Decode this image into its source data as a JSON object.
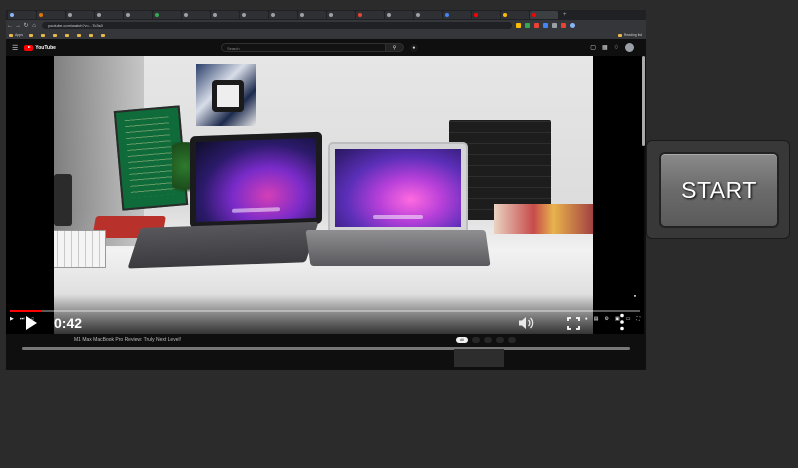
{
  "browser": {
    "tabs": [
      {
        "label": "",
        "color": "#8ab4f8"
      },
      {
        "label": "",
        "color": "#e37400"
      },
      {
        "label": "",
        "color": "#9aa0a6"
      },
      {
        "label": "",
        "color": "#9aa0a6"
      },
      {
        "label": "",
        "color": "#9aa0a6"
      },
      {
        "label": "",
        "color": "#34a853"
      },
      {
        "label": "",
        "color": "#9aa0a6"
      },
      {
        "label": "",
        "color": "#9aa0a6"
      },
      {
        "label": "",
        "color": "#9aa0a6"
      },
      {
        "label": "",
        "color": "#9aa0a6"
      },
      {
        "label": "",
        "color": "#9aa0a6"
      },
      {
        "label": "",
        "color": "#9aa0a6"
      },
      {
        "label": "",
        "color": "#ea4335"
      },
      {
        "label": "",
        "color": "#9aa0a6"
      },
      {
        "label": "",
        "color": "#9aa0a6"
      },
      {
        "label": "",
        "color": "#4285f4"
      },
      {
        "label": "",
        "color": "#ff0000"
      },
      {
        "label": "",
        "color": "#fbbc04"
      },
      {
        "label": "",
        "color": "#ff0000"
      }
    ],
    "url": "youtube.com/watch?v=...Tc3s0",
    "bookmarks": [
      "Apps",
      "",
      "",
      "",
      "",
      "",
      "",
      ""
    ],
    "bookmarks_right": "Reading list"
  },
  "youtube": {
    "logo_text": "YouTube",
    "search_placeholder": "Search",
    "player": {
      "current_time": "0:42",
      "progress_fraction": 0.05
    },
    "video_title": "M1 Max MacBook Pro Review: Truly Next Level!",
    "chips": [
      "All",
      "",
      "",
      "",
      ""
    ]
  },
  "overlay": {
    "start_label": "START"
  },
  "colors": {
    "accent_red": "#ff0000",
    "start_button_bg": "#6b6b6b"
  },
  "icons": {
    "menu": "hamburger-menu-icon",
    "search": "search-icon",
    "mic": "microphone-icon",
    "play": "play-icon",
    "volume": "volume-icon",
    "fullscreen": "fullscreen-icon",
    "more": "more-vertical-icon"
  }
}
